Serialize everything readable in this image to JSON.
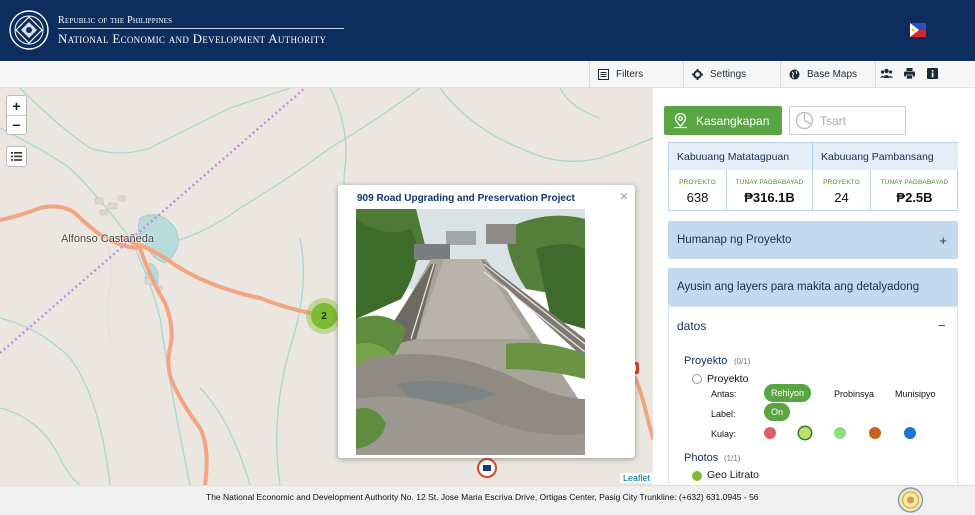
{
  "header": {
    "subtitle": "Republic of the Philippines",
    "title": "National Economic and Development Authority",
    "logo_icon": "neda-seal-icon",
    "flag_icon": "philippine-flag-icon"
  },
  "toolbar": {
    "filters": "Filters",
    "settings": "Settings",
    "basemaps": "Base Maps",
    "icons": [
      "users-icon",
      "print-icon",
      "info-icon"
    ]
  },
  "map": {
    "zoom_in": "+",
    "zoom_out": "−",
    "town_label": "Alfonso Castañeda",
    "cluster_count": "2",
    "attribution": "Leaflet",
    "popup": {
      "title": "909 Road Upgrading and Preservation Project",
      "close": "×"
    }
  },
  "sidebar": {
    "tab_tools": "Kasangkapan",
    "tab_chart": "Tsart",
    "stats": {
      "matatagpuan_label": "Kabuuang Matatagpuan",
      "pambansang_label": "Kabuuang Pambansang",
      "proyekto_label": "PROYEKTO",
      "pagbabayad_label": "TUNAY PAGBABAYAD",
      "matatagpuan_proyekto": "638",
      "matatagpuan_pagbabayad": "₱316.1B",
      "pambansang_proyekto": "24",
      "pambansang_pagbabayad": "₱2.5B"
    },
    "search_projects": "Humanap ng Proyekto",
    "search_toggle": "+",
    "layers_heading": "Ayusin ang layers para makita ang detalyadong",
    "datos_label": "datos",
    "datos_toggle": "−",
    "proyekto_group": "Proyekto",
    "proyekto_count": "(0/1)",
    "proyekto_radio": "Proyekto",
    "antas_label": "Antas:",
    "antas_options": [
      "Rehiyon",
      "Probinsya",
      "Munisipyo"
    ],
    "label_label": "Label:",
    "label_value": "On",
    "kulay_label": "Kulay:",
    "colors": [
      "#e05c6a",
      "#bde06b",
      "#8ee07d",
      "#c4631d",
      "#1f73d6"
    ],
    "photos_group": "Photos",
    "photos_count": "(1/1)",
    "photos_item": "Geo Litrato"
  },
  "footer": {
    "text": "The National Economic and Development Authority No. 12 St. Jose Maria Escriva Drive, Ortigas Center, Pasig City Trunkline: (+632) 631.0945 - 56"
  }
}
